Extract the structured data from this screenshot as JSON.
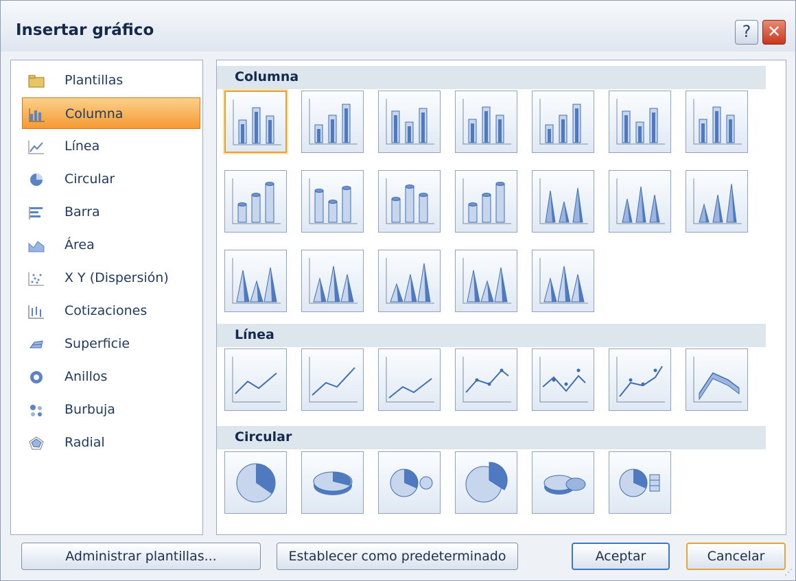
{
  "window": {
    "title": "Insertar gráfico",
    "help_label": "?",
    "close_label": "✕"
  },
  "categories": [
    {
      "label": "Plantillas",
      "icon": "folder-icon"
    },
    {
      "label": "Columna",
      "icon": "column-chart-icon",
      "selected": true
    },
    {
      "label": "Línea",
      "icon": "line-chart-icon"
    },
    {
      "label": "Circular",
      "icon": "pie-chart-icon"
    },
    {
      "label": "Barra",
      "icon": "bar-chart-icon"
    },
    {
      "label": "Área",
      "icon": "area-chart-icon"
    },
    {
      "label": "X Y (Dispersión)",
      "icon": "scatter-chart-icon"
    },
    {
      "label": "Cotizaciones",
      "icon": "stock-chart-icon"
    },
    {
      "label": "Superficie",
      "icon": "surface-chart-icon"
    },
    {
      "label": "Anillos",
      "icon": "doughnut-chart-icon"
    },
    {
      "label": "Burbuja",
      "icon": "bubble-chart-icon"
    },
    {
      "label": "Radial",
      "icon": "radar-chart-icon"
    }
  ],
  "gallery": {
    "sections": [
      {
        "title": "Columna",
        "thumbnail_count": 19,
        "selected_index": 0
      },
      {
        "title": "Línea",
        "thumbnail_count": 7
      },
      {
        "title": "Circular",
        "thumbnail_count": 6
      }
    ]
  },
  "buttons": {
    "manage": "Administrar plantillas...",
    "set_default": "Establecer como predeterminado",
    "ok": "Aceptar",
    "cancel": "Cancelar"
  },
  "scrollbar": {
    "up": "▲",
    "down": "▼",
    "grip": "≡"
  },
  "colors": {
    "selection": "#f59a32",
    "section_header": "#dde5ed",
    "icon_blue": "#3f6db0"
  }
}
